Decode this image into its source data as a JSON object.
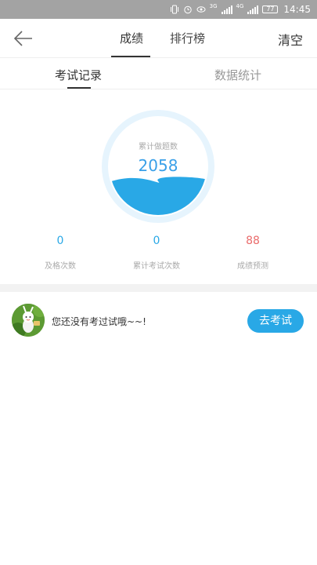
{
  "status_bar": {
    "signal_1_label": "3G",
    "signal_2_label": "4G",
    "battery": "77",
    "time": "14:45"
  },
  "header": {
    "tabs": [
      {
        "label": "成绩",
        "active": true
      },
      {
        "label": "排行榜",
        "active": false
      }
    ],
    "clear_label": "清空"
  },
  "subtabs": [
    {
      "label": "考试记录",
      "active": true
    },
    {
      "label": "数据统计",
      "active": false
    }
  ],
  "summary": {
    "ring_label": "累计做题数",
    "ring_value": "2058",
    "ring_fill_fraction": 0.34,
    "colors": {
      "accent": "#29a8e6",
      "ring_track": "#e6f4fd",
      "wave": "#29a8e6",
      "predict": "#ea6b6b"
    }
  },
  "stats": [
    {
      "value": "0",
      "label": "及格次数"
    },
    {
      "value": "0",
      "label": "累计考试次数"
    },
    {
      "value": "88",
      "label": "成绩预测"
    }
  ],
  "empty_state": {
    "message": "您还没有考过试哦~~!",
    "button_label": "去考试"
  }
}
